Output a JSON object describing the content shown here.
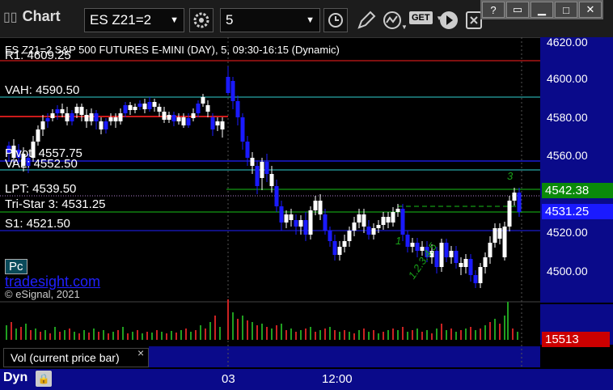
{
  "toolbar": {
    "app_title": "Chart",
    "symbol_value": "ES Z21=2",
    "interval_value": "5",
    "get_label": "GET"
  },
  "window_controls": {
    "help": "?"
  },
  "chart_header": {
    "title": "ES Z21=2 S&P 500 FUTURES E-MINI (DAY), 5, 09:30-16:15 (Dynamic)",
    "r1_label": "R1: 4609.25"
  },
  "levels": {
    "vah": "VAH: 4590.50",
    "pivot": "Pivot: 4557.75",
    "val": "VAL: 4552.50",
    "lpt": "LPT: 4539.50",
    "tristar": "Tri-Star 3: 4531.25",
    "s1": "S1: 4521.50"
  },
  "price_axis": {
    "ticks": [
      "4620.00",
      "4600.00",
      "4580.00",
      "4560.00",
      "4540.00",
      "4520.00",
      "4500.00"
    ]
  },
  "price_tags": {
    "green": "4542.38",
    "blue": "4531.25"
  },
  "watermark": {
    "badge": "Pc",
    "site": "tradesight.com",
    "copyright": "© eSignal, 2021"
  },
  "volume": {
    "label": "Vol (current price bar)",
    "close_icon": "×",
    "value": "15513"
  },
  "time_axis": {
    "labels": [
      "03",
      "12:00"
    ],
    "dyn": "Dyn"
  },
  "annotations": {
    "a3": "3",
    "a1": "1",
    "a2": "2",
    "seq": "1.2.3.4.5"
  },
  "colors": {
    "background": "#000000",
    "axis": "#0a0a8a",
    "up": "#ffffff",
    "down": "#1a1aff",
    "r1": "#cc1a1a",
    "vah": "#2fd0d0",
    "pivot": "#2020ff",
    "lpt_ema": "#19c019",
    "volume": "#cc2222",
    "vol_tag": "#cc0000",
    "green_tag": "#0a8a0a"
  }
}
